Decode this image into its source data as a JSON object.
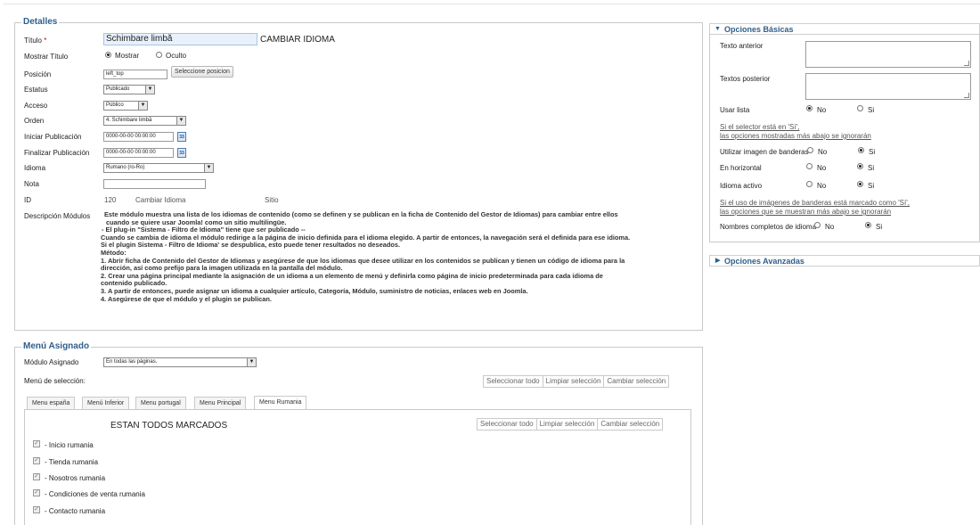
{
  "detalles": {
    "legend": "Detalles",
    "titulo_label": "Título",
    "titulo_required": "*",
    "titulo_value": "Schimbare limbă",
    "titulo_display": "CAMBIAR IDIOMA",
    "mostrar_titulo_label": "Mostrar Título",
    "mostrar_option": "Mostrar",
    "oculto_option": "Oculto",
    "posicion_label": "Posición",
    "posicion_value": "left_top",
    "posicion_button": "Seleccione posicion",
    "estatus_label": "Estatus",
    "estatus_value": "Publicado",
    "acceso_label": "Acceso",
    "acceso_value": "Público",
    "orden_label": "Orden",
    "orden_value": "4. Schimbare limbă",
    "iniciar_label": "Iniciar Publicación",
    "iniciar_value": "0000-00-00 00:00:00",
    "finalizar_label": "Finalizar Publicación",
    "finalizar_value": "0000-00-00 00:00:00",
    "idioma_label": "Idioma",
    "idioma_value": "Rumano (ro-Ro)",
    "nota_label": "Nota",
    "nota_value": "",
    "id_label": "ID",
    "id_value": "120",
    "id_module_name": "Cambiar Idioma",
    "id_client": "Sitio",
    "descripcion_label": "Descripción Módulos",
    "descripcion_lines": [
      "Este módulo muestra una lista de los idiomas de contenido (como se definen y se publican en la ficha de Contenido del Gestor de Idiomas) para cambiar entre ellos",
      "cuando se quiere usar Joomla! como un sitio multilingüe.",
      "- El plug-in \"Sistema - Filtro de Idioma\" tiene que ser publicado --",
      "Cuando se cambia de idioma el módulo redirige a la página de inicio definida para el idioma elegido. A partir de entonces, la navegación será el definida para ese idioma.",
      "Si el plugin Sistema - Filtro de Idioma' se despublica, esto puede tener resultados no deseados.",
      "Método:",
      "1. Abrir ficha de Contenido del Gestor de Idiomas y asegúrese de que los idiomas que desee utilizar en los contenidos se publican y tienen un código de idioma para la",
      "dirección, así como prefijo para la imagen utilizada en la pantalla del módulo.",
      "2. Crear una página principal mediante la asignación de un idioma a un elemento de menú y definirla como página de inicio predeterminada para cada idioma de",
      "contenido publicado.",
      "3. A partir de entonces, puede asignar un idioma a cualquier artículo, Categoría, Módulo, suministro de noticias, enlaces web en Joomla.",
      "4. Asegúrese de que el módulo y el plugin se publican."
    ]
  },
  "menu": {
    "legend": "Menú Asignado",
    "modulo_label": "Módulo Asignado",
    "modulo_value": "En todas las páginas.",
    "seleccion_label": "Menú de selección:",
    "buttons": [
      "Seleccionar todo",
      "Limpiar selección",
      "Cambiar selección"
    ],
    "tabs": [
      "Menu españa",
      "Menú Inferior",
      "Menu portugal",
      "Menu Principal",
      "Menu Rumania"
    ],
    "tab_heading": "ESTAN TODOS MARCADOS",
    "tab_buttons": [
      "Seleccionar todo",
      "Limpiar selección",
      "Cambiar selección"
    ],
    "items": [
      "- Inicio rumania",
      "- Tienda rumania",
      "- Nosotros rumania",
      "- Condiciones de venta rumania",
      "- Contacto rumania"
    ]
  },
  "opciones_basicas": {
    "header": "Opciones Básicas",
    "texto_anterior": "Texto anterior",
    "textos_posterior": "Textos posterior",
    "usar_lista": "Usar lista",
    "no": "No",
    "si": "Si",
    "note1_line1": "Si el selector está en 'Sí',",
    "note1_line2": "las opciones mostradas más abajo se ignorarán",
    "utilizar_banderas": "Utilizar imagen de banderas",
    "en_horizontal": "En horizontal",
    "idioma_activo": "Idioma activo",
    "note2_line1": "Si el uso de imágenes de banderas está marcado como 'Sí',",
    "note2_line2": "las opciones que se muestran más abajo se ignorarán",
    "nombres_completos": "Nombres completos de idioma"
  },
  "opciones_avanzadas": {
    "header": "Opciones Avanzadas"
  }
}
